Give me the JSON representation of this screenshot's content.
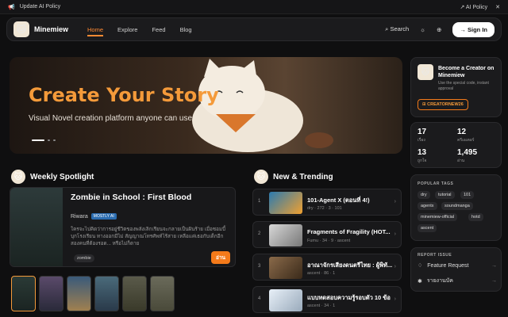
{
  "topbar": {
    "announcement": "Update AI Policy",
    "ai_policy": "AI Policy"
  },
  "nav": {
    "brand": "Minemiew",
    "items": [
      "Home",
      "Explore",
      "Feed",
      "Blog"
    ],
    "search": "Search",
    "signin": "Sign In"
  },
  "hero": {
    "title": "Create Your Story",
    "subtitle": "Visual Novel creation platform anyone can use"
  },
  "spotlight": {
    "heading": "Weekly Spotlight",
    "title": "Zombie in School : First Blood",
    "author": "Riwara",
    "badge": "MOSTLY AI",
    "description": "ใครจะไปคิดว่าการอยู่ชีวิตของพลังเลิกเรียนจะกลายเป็นฝันร้าย เมื่อซอมบี้บุกโรงเรียน ทางออกมีไม่ สัญญาณโทรศัพท์ไร้สาย เหลือแค่เธอกับเด็กอีกสองคนที่ต้องรอด... หรือไม่ก็ตาย",
    "tag": "zombie",
    "read_button": "อ่าน"
  },
  "trending": {
    "heading": "New & Trending",
    "items": [
      {
        "num": "1",
        "title": "101-Agent X (ตอนที่ 4!)",
        "meta": "dry  ·  272  ·  3  ·  101"
      },
      {
        "num": "2",
        "title": "Fragments of Fragility (HOT...",
        "meta": "Fumu  ·  34  ·  9  ·  ascent"
      },
      {
        "num": "3",
        "title": "อาณาจักรเสียงดนตรีไทย : ผู้พิทั...",
        "meta": "ascent  ·  86  ·  1"
      },
      {
        "num": "4",
        "title": "แบบทดสอบความรู้รอบตัว 10 ข้อ",
        "meta": "ascent  ·  34  ·  1"
      }
    ]
  },
  "creator": {
    "title": "Become a Creator on Minemiew",
    "subtitle": "Use the special code, instant approval",
    "code": "CREATORNEW26"
  },
  "stats": [
    {
      "value": "17",
      "label": "เรื่อง"
    },
    {
      "value": "12",
      "label": "ครีเอเตอร์"
    },
    {
      "value": "13",
      "label": "ถูกใจ"
    },
    {
      "value": "1,495",
      "label": "อ่าน"
    }
  ],
  "popular_tags": {
    "heading": "POPULAR TAGS",
    "tags": [
      "dry",
      "tutorial",
      "101",
      "agentx",
      "soundmanga",
      "minemiew-official",
      "hotd",
      "ascent"
    ]
  },
  "report": {
    "heading": "REPORT ISSUE",
    "items": [
      "Feature Request",
      "รายงานบัค"
    ]
  }
}
